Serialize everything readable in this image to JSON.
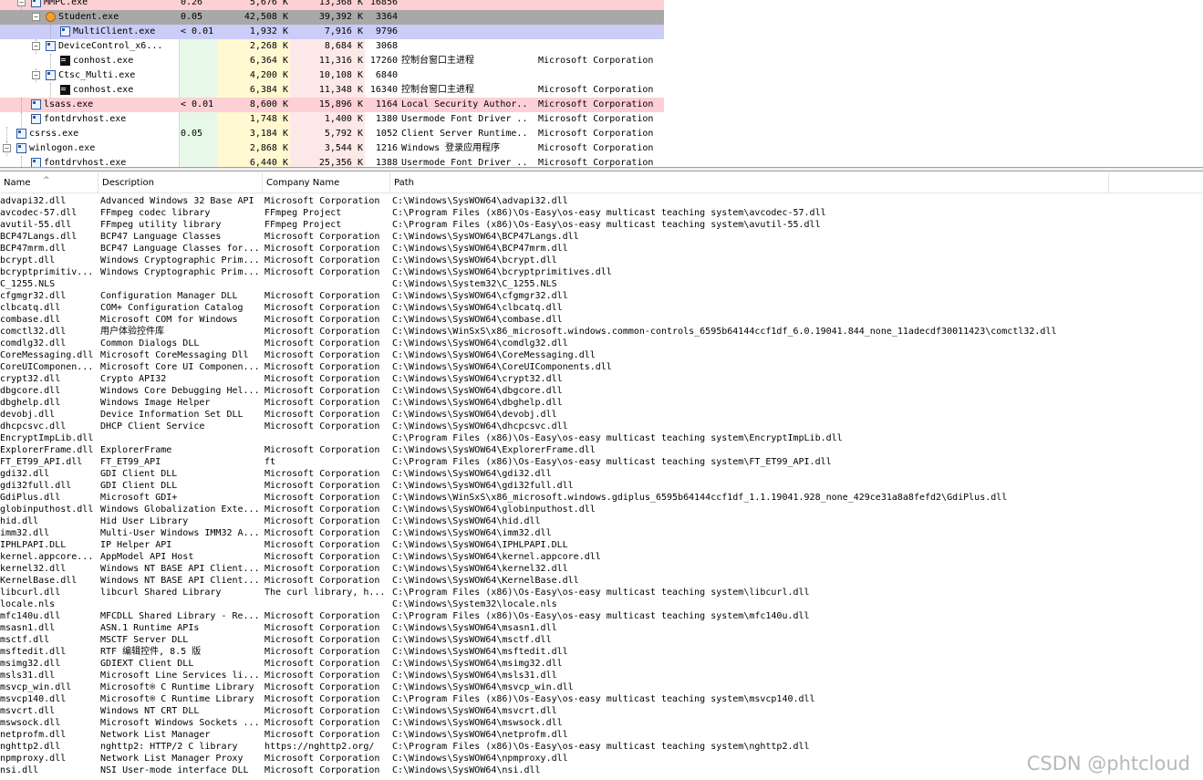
{
  "process_tree": {
    "rows": [
      {
        "name": "MMPC.exe",
        "cpu": "0.26",
        "private": "5,676 K",
        "working_set": "13,368 K",
        "pid": "16856",
        "desc": "",
        "company": "",
        "indent": 2,
        "toggle": "−",
        "icon": "win",
        "bg": "#fcd0d4"
      },
      {
        "name": "Student.exe",
        "cpu": "0.05",
        "private": "42,508 K",
        "working_set": "39,392 K",
        "pid": "3364",
        "desc": "",
        "company": "",
        "indent": 3,
        "toggle": "−",
        "icon": "student",
        "bg": "#a8a8a8"
      },
      {
        "name": "MultiClient.exe",
        "cpu": "< 0.01",
        "private": "1,932 K",
        "working_set": "7,916 K",
        "pid": "9796",
        "desc": "",
        "company": "",
        "indent": 4,
        "toggle": "",
        "icon": "win",
        "bg": "#ccccf8"
      },
      {
        "name": "DeviceControl_x6...",
        "cpu": "",
        "private": "2,268 K",
        "working_set": "8,684 K",
        "pid": "3068",
        "desc": "",
        "company": "",
        "indent": 3,
        "toggle": "−",
        "icon": "win",
        "bg": ""
      },
      {
        "name": "conhost.exe",
        "cpu": "",
        "private": "6,364 K",
        "working_set": "11,316 K",
        "pid": "17260",
        "desc": "控制台窗口主进程",
        "company": "Microsoft Corporation",
        "indent": 4,
        "toggle": "",
        "icon": "cmd",
        "bg": ""
      },
      {
        "name": "Ctsc_Multi.exe",
        "cpu": "",
        "private": "4,200 K",
        "working_set": "10,108 K",
        "pid": "6840",
        "desc": "",
        "company": "",
        "indent": 3,
        "toggle": "−",
        "icon": "win",
        "bg": ""
      },
      {
        "name": "conhost.exe",
        "cpu": "",
        "private": "6,384 K",
        "working_set": "11,348 K",
        "pid": "16340",
        "desc": "控制台窗口主进程",
        "company": "Microsoft Corporation",
        "indent": 4,
        "toggle": "",
        "icon": "cmd",
        "bg": ""
      },
      {
        "name": "lsass.exe",
        "cpu": "< 0.01",
        "private": "8,600 K",
        "working_set": "15,896 K",
        "pid": "1164",
        "desc": "Local Security Author...",
        "company": "Microsoft Corporation",
        "indent": 2,
        "toggle": "",
        "icon": "win",
        "bg": "#fcd0d4"
      },
      {
        "name": "fontdrvhost.exe",
        "cpu": "",
        "private": "1,748 K",
        "working_set": "1,400 K",
        "pid": "1380",
        "desc": "Usermode Font Driver ...",
        "company": "Microsoft Corporation",
        "indent": 2,
        "toggle": "",
        "icon": "win",
        "bg": ""
      },
      {
        "name": "csrss.exe",
        "cpu": "0.05",
        "private": "3,184 K",
        "working_set": "5,792 K",
        "pid": "1052",
        "desc": "Client Server Runtime...",
        "company": "Microsoft Corporation",
        "indent": 1,
        "toggle": "",
        "icon": "win",
        "bg": ""
      },
      {
        "name": "winlogon.exe",
        "cpu": "",
        "private": "2,868 K",
        "working_set": "3,544 K",
        "pid": "1216",
        "desc": "Windows 登录应用程序",
        "company": "Microsoft Corporation",
        "indent": 1,
        "toggle": "−",
        "icon": "win",
        "bg": ""
      },
      {
        "name": "fontdrvhost.exe",
        "cpu": "",
        "private": "6,440 K",
        "working_set": "25,356 K",
        "pid": "1388",
        "desc": "Usermode Font Driver ...",
        "company": "Microsoft Corporation",
        "indent": 2,
        "toggle": "",
        "icon": "win",
        "bg": ""
      }
    ]
  },
  "dll_list": {
    "headers": {
      "name": "Name",
      "description": "Description",
      "company": "Company Name",
      "path": "Path"
    },
    "rows": [
      [
        "advapi32.dll",
        "Advanced Windows 32 Base API",
        "Microsoft Corporation",
        "C:\\Windows\\SysWOW64\\advapi32.dll"
      ],
      [
        "avcodec-57.dll",
        "FFmpeg codec library",
        "FFmpeg Project",
        "C:\\Program Files (x86)\\Os-Easy\\os-easy multicast teaching system\\avcodec-57.dll"
      ],
      [
        "avutil-55.dll",
        "FFmpeg utility library",
        "FFmpeg Project",
        "C:\\Program Files (x86)\\Os-Easy\\os-easy multicast teaching system\\avutil-55.dll"
      ],
      [
        "BCP47Langs.dll",
        "BCP47 Language Classes",
        "Microsoft Corporation",
        "C:\\Windows\\SysWOW64\\BCP47Langs.dll"
      ],
      [
        "BCP47mrm.dll",
        "BCP47 Language Classes for...",
        "Microsoft Corporation",
        "C:\\Windows\\SysWOW64\\BCP47mrm.dll"
      ],
      [
        "bcrypt.dll",
        "Windows Cryptographic Prim...",
        "Microsoft Corporation",
        "C:\\Windows\\SysWOW64\\bcrypt.dll"
      ],
      [
        "bcryptprimitiv...",
        "Windows Cryptographic Prim...",
        "Microsoft Corporation",
        "C:\\Windows\\SysWOW64\\bcryptprimitives.dll"
      ],
      [
        "C_1255.NLS",
        "",
        "",
        "C:\\Windows\\System32\\C_1255.NLS"
      ],
      [
        "cfgmgr32.dll",
        "Configuration Manager DLL",
        "Microsoft Corporation",
        "C:\\Windows\\SysWOW64\\cfgmgr32.dll"
      ],
      [
        "clbcatq.dll",
        "COM+ Configuration Catalog",
        "Microsoft Corporation",
        "C:\\Windows\\SysWOW64\\clbcatq.dll"
      ],
      [
        "combase.dll",
        "Microsoft COM for Windows",
        "Microsoft Corporation",
        "C:\\Windows\\SysWOW64\\combase.dll"
      ],
      [
        "comctl32.dll",
        "用户体验控件库",
        "Microsoft Corporation",
        "C:\\Windows\\WinSxS\\x86_microsoft.windows.common-controls_6595b64144ccf1df_6.0.19041.844_none_11adecdf30011423\\comctl32.dll"
      ],
      [
        "comdlg32.dll",
        "Common Dialogs DLL",
        "Microsoft Corporation",
        "C:\\Windows\\SysWOW64\\comdlg32.dll"
      ],
      [
        "CoreMessaging.dll",
        "Microsoft CoreMessaging Dll",
        "Microsoft Corporation",
        "C:\\Windows\\SysWOW64\\CoreMessaging.dll"
      ],
      [
        "CoreUIComponen...",
        "Microsoft Core UI Componen...",
        "Microsoft Corporation",
        "C:\\Windows\\SysWOW64\\CoreUIComponents.dll"
      ],
      [
        "crypt32.dll",
        "Crypto API32",
        "Microsoft Corporation",
        "C:\\Windows\\SysWOW64\\crypt32.dll"
      ],
      [
        "dbgcore.dll",
        "Windows Core Debugging Hel...",
        "Microsoft Corporation",
        "C:\\Windows\\SysWOW64\\dbgcore.dll"
      ],
      [
        "dbghelp.dll",
        "Windows Image Helper",
        "Microsoft Corporation",
        "C:\\Windows\\SysWOW64\\dbghelp.dll"
      ],
      [
        "devobj.dll",
        "Device Information Set DLL",
        "Microsoft Corporation",
        "C:\\Windows\\SysWOW64\\devobj.dll"
      ],
      [
        "dhcpcsvc.dll",
        "DHCP Client Service",
        "Microsoft Corporation",
        "C:\\Windows\\SysWOW64\\dhcpcsvc.dll"
      ],
      [
        "EncryptImpLib.dll",
        "",
        "",
        "C:\\Program Files (x86)\\Os-Easy\\os-easy multicast teaching system\\EncryptImpLib.dll"
      ],
      [
        "ExplorerFrame.dll",
        "ExplorerFrame",
        "Microsoft Corporation",
        "C:\\Windows\\SysWOW64\\ExplorerFrame.dll"
      ],
      [
        "FT_ET99_API.dll",
        "FT_ET99_API",
        "ft",
        "C:\\Program Files (x86)\\Os-Easy\\os-easy multicast teaching system\\FT_ET99_API.dll"
      ],
      [
        "gdi32.dll",
        "GDI Client DLL",
        "Microsoft Corporation",
        "C:\\Windows\\SysWOW64\\gdi32.dll"
      ],
      [
        "gdi32full.dll",
        "GDI Client DLL",
        "Microsoft Corporation",
        "C:\\Windows\\SysWOW64\\gdi32full.dll"
      ],
      [
        "GdiPlus.dll",
        "Microsoft GDI+",
        "Microsoft Corporation",
        "C:\\Windows\\WinSxS\\x86_microsoft.windows.gdiplus_6595b64144ccf1df_1.1.19041.928_none_429ce31a8a8fefd2\\GdiPlus.dll"
      ],
      [
        "globinputhost.dll",
        "Windows Globalization Exte...",
        "Microsoft Corporation",
        "C:\\Windows\\SysWOW64\\globinputhost.dll"
      ],
      [
        "hid.dll",
        "Hid User Library",
        "Microsoft Corporation",
        "C:\\Windows\\SysWOW64\\hid.dll"
      ],
      [
        "imm32.dll",
        "Multi-User Windows IMM32 A...",
        "Microsoft Corporation",
        "C:\\Windows\\SysWOW64\\imm32.dll"
      ],
      [
        "IPHLPAPI.DLL",
        "IP Helper API",
        "Microsoft Corporation",
        "C:\\Windows\\SysWOW64\\IPHLPAPI.DLL"
      ],
      [
        "kernel.appcore...",
        "AppModel API Host",
        "Microsoft Corporation",
        "C:\\Windows\\SysWOW64\\kernel.appcore.dll"
      ],
      [
        "kernel32.dll",
        "Windows NT BASE API Client...",
        "Microsoft Corporation",
        "C:\\Windows\\SysWOW64\\kernel32.dll"
      ],
      [
        "KernelBase.dll",
        "Windows NT BASE API Client...",
        "Microsoft Corporation",
        "C:\\Windows\\SysWOW64\\KernelBase.dll"
      ],
      [
        "libcurl.dll",
        "libcurl Shared Library",
        "The curl library, h...",
        "C:\\Program Files (x86)\\Os-Easy\\os-easy multicast teaching system\\libcurl.dll"
      ],
      [
        "locale.nls",
        "",
        "",
        "C:\\Windows\\System32\\locale.nls"
      ],
      [
        "mfc140u.dll",
        "MFCDLL Shared Library - Re...",
        "Microsoft Corporation",
        "C:\\Program Files (x86)\\Os-Easy\\os-easy multicast teaching system\\mfc140u.dll"
      ],
      [
        "msasn1.dll",
        "ASN.1 Runtime APIs",
        "Microsoft Corporation",
        "C:\\Windows\\SysWOW64\\msasn1.dll"
      ],
      [
        "msctf.dll",
        "MSCTF Server DLL",
        "Microsoft Corporation",
        "C:\\Windows\\SysWOW64\\msctf.dll"
      ],
      [
        "msftedit.dll",
        "RTF 编辑控件, 8.5 版",
        "Microsoft Corporation",
        "C:\\Windows\\SysWOW64\\msftedit.dll"
      ],
      [
        "msimg32.dll",
        "GDIEXT Client DLL",
        "Microsoft Corporation",
        "C:\\Windows\\SysWOW64\\msimg32.dll"
      ],
      [
        "msls31.dll",
        "Microsoft Line Services li...",
        "Microsoft Corporation",
        "C:\\Windows\\SysWOW64\\msls31.dll"
      ],
      [
        "msvcp_win.dll",
        "Microsoft® C Runtime Library",
        "Microsoft Corporation",
        "C:\\Windows\\SysWOW64\\msvcp_win.dll"
      ],
      [
        "msvcp140.dll",
        "Microsoft® C Runtime Library",
        "Microsoft Corporation",
        "C:\\Program Files (x86)\\Os-Easy\\os-easy multicast teaching system\\msvcp140.dll"
      ],
      [
        "msvcrt.dll",
        "Windows NT CRT DLL",
        "Microsoft Corporation",
        "C:\\Windows\\SysWOW64\\msvcrt.dll"
      ],
      [
        "mswsock.dll",
        "Microsoft Windows Sockets ...",
        "Microsoft Corporation",
        "C:\\Windows\\SysWOW64\\mswsock.dll"
      ],
      [
        "netprofm.dll",
        "Network List Manager",
        "Microsoft Corporation",
        "C:\\Windows\\SysWOW64\\netprofm.dll"
      ],
      [
        "nghttp2.dll",
        "nghttp2: HTTP/2 C library",
        "https://nghttp2.org/",
        "C:\\Program Files (x86)\\Os-Easy\\os-easy multicast teaching system\\nghttp2.dll"
      ],
      [
        "npmproxy.dll",
        "Network List Manager Proxy",
        "Microsoft Corporation",
        "C:\\Windows\\SysWOW64\\npmproxy.dll"
      ],
      [
        "nsi.dll",
        "NSI User-mode interface DLL",
        "Microsoft Corporation",
        "C:\\Windows\\SysWOW64\\nsi.dll"
      ]
    ]
  },
  "watermark": "CSDN @phtcloud",
  "colors": {
    "cpu_column": "#e8f8e8",
    "private_column": "#fff8d0",
    "working_set_column": "#fde8e8",
    "service_row": "#fcd0d4",
    "selected_row": "#a8a8a8",
    "own_process_row": "#ccccf8"
  }
}
